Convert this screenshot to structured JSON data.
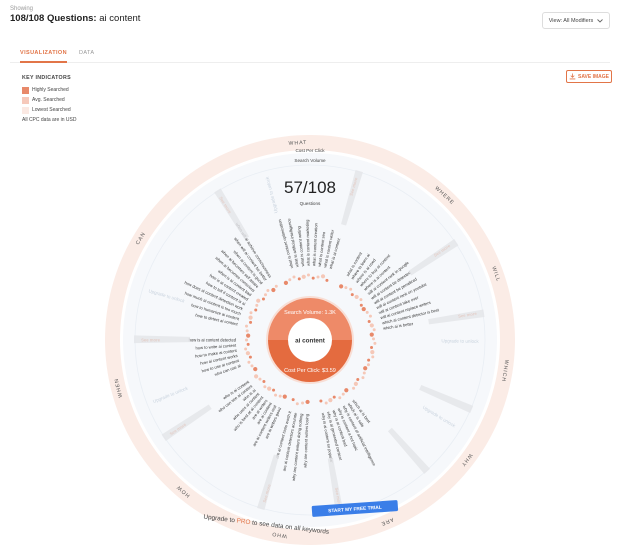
{
  "header": {
    "showing": "Showing",
    "count": "108/108 Questions:",
    "keyword": "ai content",
    "modifiers_button": "View: All Modifiers"
  },
  "tabs": [
    {
      "label": "VISUALIZATION",
      "active": true
    },
    {
      "label": "DATA",
      "active": false
    }
  ],
  "toolbar": {
    "save_label": "SAVE IMAGE"
  },
  "legend": {
    "title": "KEY INDICATORS",
    "items": [
      {
        "label": "Highly Searched",
        "color": "#e8896a"
      },
      {
        "label": "Avg. Searched",
        "color": "#f6c9bb"
      },
      {
        "label": "Lowest Searched",
        "color": "#fbe9e3"
      }
    ],
    "note": "All CPC data are in USD"
  },
  "wheel": {
    "top_labels": [
      "Cost Per Click",
      "Search Volume"
    ],
    "ratio": "57/108",
    "ratio_label": "Questions",
    "center_keyword": "ai content",
    "search_volume": "Search Volume: 1.3K",
    "cost_per_click": "Cost Per Click: $3.59",
    "upgrade_text_a": "Upgrade to ",
    "upgrade_text_pro": "PRO",
    "upgrade_text_b": " to see data on all keywords",
    "trial_button": "START MY FREE TRIAL",
    "modifiers": [
      "WHAT",
      "WHERE",
      "WILL",
      "WHICH",
      "WHY",
      "ARE",
      "WHO",
      "HOW",
      "WHEN",
      "CAN"
    ],
    "upgrade_unlock": "Upgrade to unlock",
    "see_more": "See more",
    "questions": [
      "what is content optimization",
      "what is artificial intelligence",
      "what is content writing",
      "what is content marketing",
      "what is content creation",
      "what is content seo",
      "what is content writer",
      "what is ai content",
      "what is content",
      "where to learn ai",
      "where is ai used",
      "where to buy ai content",
      "where is ai content",
      "will ai content rank in google",
      "will ai content be detected",
      "will ai content be penalized",
      "will ai content rank on youtube",
      "will ai content take over",
      "will ai content replace writers",
      "which ai content detector is best",
      "which ai is better",
      "which ai is best",
      "which ai is safe",
      "why is content of artificial intelligence",
      "why is content a hot topic",
      "why is ai content bad",
      "why is ai generated content",
      "why is ai content so popular",
      "why are content writers losing",
      "why are content writers doing nothing",
      "are ai content detectors accurate",
      "are ai content tools worth it",
      "are ai writers good",
      "are ai content writers real",
      "are ai content",
      "are ai writers",
      "who is best at ai content",
      "who uses ai content",
      "who is ai",
      "who can see ai content",
      "who is ai content",
      "who can use ai",
      "how to use ai content",
      "how ai content works",
      "how to make ai content",
      "how to write ai content",
      "how is ai content detected",
      "how to detect ai content",
      "how to humanize ai content",
      "how much ai content is too much",
      "how does ai content detection work",
      "how to tell if content is ai",
      "how is ai content created",
      "when is ai content bad",
      "when ai becomes conscious",
      "when ai becomes self aware",
      "when ai content is good",
      "when will ai content be better",
      "when will ai achieve consciousness",
      "can ai content be copyrighted",
      "can ai content be detected",
      "can ai content rank on google",
      "can ai content be monetized on youtube",
      "can ai content rank in google",
      "does ai content work",
      "can ai content be trusted",
      "can ai content pass plagiarism"
    ]
  }
}
